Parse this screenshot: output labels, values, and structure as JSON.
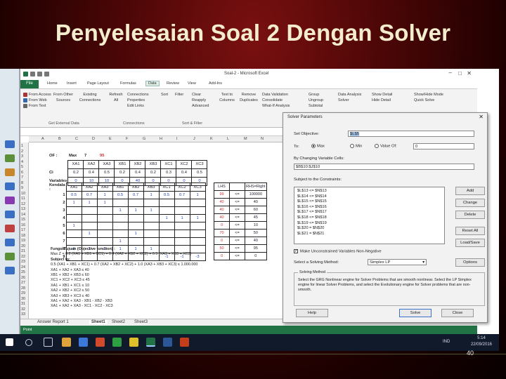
{
  "slide": {
    "title": "Penyelesaian Soal 2 Dengan Solver",
    "page_number": "40"
  },
  "excel": {
    "window_title": "Soal-2 - Microsoft Excel",
    "tabs": [
      "File",
      "Home",
      "Insert",
      "Page Layout",
      "Formulas",
      "Data",
      "Review",
      "View",
      "Add-Ins"
    ],
    "active_tab": "Data",
    "ribbon": {
      "get_external": [
        "From Access",
        "From Web",
        "From Text"
      ],
      "from_other": "From Other Sources",
      "existing": "Existing Connections",
      "refresh": "Refresh All",
      "connections": [
        "Connections",
        "Properties",
        "Edit Links"
      ],
      "sort": [
        "Sort",
        "Filter"
      ],
      "filter_opts": [
        "Clear",
        "Reapply",
        "Advanced"
      ],
      "text_to_col": "Text to Columns",
      "remove_dup": "Remove Duplicates",
      "validation": [
        "Data Validation",
        "Consolidate",
        "What-If Analysis"
      ],
      "outline": [
        "Group",
        "Ungroup",
        "Subtotal"
      ],
      "analysis": [
        "Data Analysis",
        "Solver"
      ],
      "detail": [
        "Show Detail",
        "Hide Detail"
      ],
      "extra": [
        "Show/Hide Mode",
        "Quick Solve"
      ],
      "group_labels": [
        "Get External Data",
        "Connections",
        "Sort & Filter"
      ]
    },
    "columns": [
      "A",
      "B",
      "C",
      "D",
      "E",
      "F",
      "G",
      "H",
      "I",
      "J",
      "K",
      "L",
      "M",
      "N"
    ],
    "rows": [
      "1",
      "2",
      "3",
      "4",
      "5",
      "6",
      "7",
      "8",
      "9",
      "10",
      "11",
      "12",
      "13",
      "14",
      "15",
      "16",
      "17",
      "18",
      "19",
      "20",
      "21",
      "22",
      "23",
      "24",
      "25",
      "26",
      "27",
      "28",
      "29",
      "30",
      "31",
      "32",
      "33"
    ],
    "t1": {
      "headers": [
        "XA1",
        "XA2",
        "XA3",
        "XB1",
        "XB2",
        "XB3",
        "XC1",
        "XC2",
        "XC3"
      ],
      "of_label": "OF :",
      "max": "Max",
      "max_val": "7",
      "of_val": "95",
      "ci_label": "Ci",
      "ci": [
        "0.2",
        "0.4",
        "0.5",
        "0.2",
        "0.4",
        "0.2",
        "0.3",
        "0.4",
        "0.5"
      ],
      "var_label": "Variables",
      "vars": [
        "0",
        "10",
        "10",
        "0",
        "40",
        "0",
        "0",
        "0",
        "0"
      ]
    },
    "t2": {
      "label": "Kendala :",
      "headers": [
        "XA1",
        "XA2",
        "XA3",
        "XB1",
        "XB2",
        "XB3",
        "XC1",
        "XC2",
        "XC3"
      ],
      "rows": [
        {
          "n": "1",
          "v": [
            "0.5",
            "0.7",
            "1",
            "0.5",
            "0.7",
            "1",
            "0.5",
            "0.7",
            "1"
          ]
        },
        {
          "n": "2",
          "v": [
            "1",
            "1",
            "1",
            "",
            "",
            "",
            "",
            "",
            ""
          ]
        },
        {
          "n": "3",
          "v": [
            "",
            "",
            "",
            "1",
            "1",
            "1",
            "",
            "",
            ""
          ]
        },
        {
          "n": "4",
          "v": [
            "",
            "",
            "",
            "",
            "",
            "",
            "1",
            "1",
            "1"
          ]
        },
        {
          "n": "5",
          "v": [
            "1",
            "",
            "",
            "",
            "",
            "",
            "",
            "",
            ""
          ]
        },
        {
          "n": "6",
          "v": [
            "",
            "1",
            "",
            "",
            "1",
            "",
            "",
            "",
            ""
          ]
        },
        {
          "n": "7",
          "v": [
            "",
            "",
            "",
            "1",
            "",
            "",
            "",
            "",
            ""
          ]
        },
        {
          "n": "8",
          "v": [
            "1",
            "1",
            "1",
            "1",
            "1",
            "1",
            "",
            "",
            ""
          ]
        },
        {
          "n": "9",
          "v": [
            "",
            "",
            "",
            "",
            "",
            "",
            "-1",
            "-1",
            "-3"
          ]
        }
      ]
    },
    "rhs": {
      "headers": [
        "LHS",
        "",
        "RHS=Right"
      ],
      "rows": [
        [
          "99",
          "<=",
          "100000"
        ],
        [
          "40",
          "<=",
          "40"
        ],
        [
          "40",
          "<=",
          "60"
        ],
        [
          "40",
          "<=",
          "45"
        ],
        [
          "0",
          "<=",
          "10"
        ],
        [
          "70",
          "<=",
          "50"
        ],
        [
          "0",
          "<=",
          "40"
        ],
        [
          "50",
          "<=",
          "95"
        ],
        [
          "0",
          "<=",
          "0"
        ]
      ]
    },
    "notes": {
      "h1": "Fungsi Tujuan (Objective function) :",
      "f1": "Max Z = 0.2 (XA1 + XB1 + XC1) + 0.4 (XA2 + XB2 + XC2) + 0.5 (XA3 + XB3 + XC3)",
      "h2": "Subject to:",
      "lines": [
        "0.5 (XA1 + XB1 + XC1) + 0.7 (XA2 + XB2 + XC2) + 1.0 (XA3 + XB3 + XC3) ≤ 1.000.000",
        "XA1 + XA2 + XA3 ≤ 40",
        "XB1 + XB2 + XB3 ≤ 60",
        "XC1 + XC2 + XC3 ≤ 45",
        "XA1 + XB1 + XC1 ≤ 10",
        "XA2 + XB2 + XC2 ≤ 50",
        "XA3 + XB3 + XC3 ≤ 40",
        "XA1 + XA2 + XA3 - XB1 - XB2 - XB3",
        "XA1 + XA2 + XA3 - XC1 - XC2 - XC3"
      ]
    },
    "sheets": [
      "Answer Report 1",
      "Sheet1",
      "Sheet2",
      "Sheet3"
    ],
    "status": "Point"
  },
  "solver": {
    "title": "Solver Parameters",
    "set_objective_label": "Set Objective:",
    "objective": "$L$5",
    "to_label": "To:",
    "opt_max": "Max",
    "opt_min": "Min",
    "opt_value": "Value Of:",
    "value_of": "0",
    "changing_label": "By Changing Variable Cells:",
    "changing": "$B$10:$J$10",
    "constraints_label": "Subject to the Constraints:",
    "constraints": [
      "$L$13 <= $N$13",
      "$L$14 <= $N$14",
      "$L$15 <= $N$15",
      "$L$16 <= $N$16",
      "$L$17 <= $N$17",
      "$L$18 <= $N$18",
      "$L$19 <= $N$19",
      "$L$20 = $N$20",
      "$L$21 = $N$21"
    ],
    "btn_add": "Add",
    "btn_change": "Change",
    "btn_delete": "Delete",
    "btn_reset": "Reset All",
    "btn_loadsave": "Load/Save",
    "unconstrained": "Make Unconstrained Variables Non-Negative",
    "method_label": "Select a Solving Method:",
    "method": "Simplex LP",
    "btn_options": "Options",
    "method_title": "Solving Method",
    "method_desc": "Select the GRG Nonlinear engine for Solver Problems that are smooth nonlinear. Select the LP Simplex engine for linear Solver Problems, and select the Evolutionary engine for Solver problems that are non-smooth.",
    "btn_help": "Help",
    "btn_solve": "Solve",
    "btn_close": "Close"
  },
  "taskbar": {
    "time": "5:14",
    "date": "22/09/2016",
    "lang": "IND"
  }
}
